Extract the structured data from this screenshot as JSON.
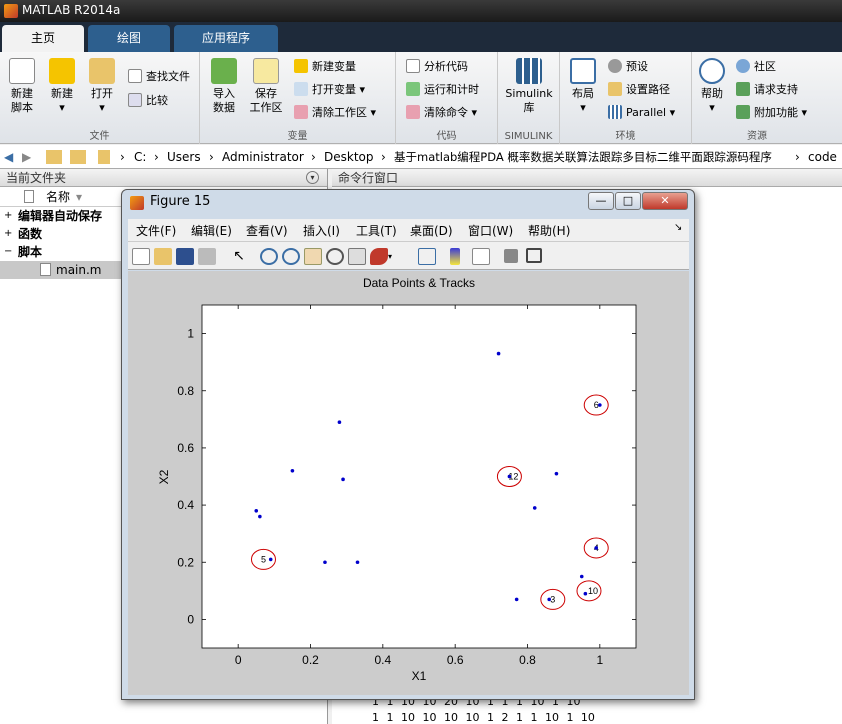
{
  "app": {
    "title": "MATLAB R2014a"
  },
  "ribbon_tabs": [
    {
      "label": "主页",
      "active": true
    },
    {
      "label": "绘图",
      "active": false
    },
    {
      "label": "应用程序",
      "active": false
    }
  ],
  "ribbon": {
    "file_group": {
      "label": "文件",
      "new_script": "新建\n脚本",
      "new": "新建",
      "open": "打开",
      "find_files": "查找文件",
      "compare": "比较"
    },
    "variable_group": {
      "label": "变量",
      "import": "导入\n数据",
      "save_ws": "保存\n工作区",
      "new_var": "新建变量",
      "open_var": "打开变量",
      "clear_ws": "清除工作区"
    },
    "code_group": {
      "label": "代码",
      "analyze": "分析代码",
      "run_time": "运行和计时",
      "clear_cmd": "清除命令"
    },
    "simulink_group": {
      "label": "SIMULINK",
      "simulink": "Simulink\n库"
    },
    "env_group": {
      "label": "环境",
      "layout": "布局",
      "prefs": "预设",
      "set_path": "设置路径",
      "parallel": "Parallel"
    },
    "res_group": {
      "label": "资源",
      "help": "帮助",
      "community": "社区",
      "support": "请求支持",
      "addons": "附加功能"
    }
  },
  "address": {
    "crumbs": [
      "C:",
      "Users",
      "Administrator",
      "Desktop",
      "基于matlab编程PDA 概率数据关联算法跟踪多目标二维平面跟踪源码程序",
      "code"
    ]
  },
  "current_folder": {
    "title": "当前文件夹",
    "col_name": "名称",
    "items": [
      {
        "label": "编辑器自动保存",
        "type": "folder",
        "toggle": "+"
      },
      {
        "label": "函数",
        "type": "folder",
        "toggle": "+"
      },
      {
        "label": "脚本",
        "type": "folder",
        "toggle": "−"
      },
      {
        "label": "main.m",
        "type": "file",
        "selected": true
      }
    ]
  },
  "command_window": {
    "title": "命令行窗口",
    "rows": [
      "1 1 10 10 20 10 1 1 1 10 1 10",
      "1 1 10 10 10 10 1 2 1 1 10 1 10"
    ]
  },
  "figure": {
    "title": "Figure 15",
    "menu": [
      "文件(F)",
      "编辑(E)",
      "查看(V)",
      "插入(I)",
      "工具(T)",
      "桌面(D)",
      "窗口(W)",
      "帮助(H)"
    ],
    "win_buttons": [
      "—",
      "□",
      "✕"
    ]
  },
  "chart_data": {
    "type": "scatter",
    "title": "Data Points & Tracks",
    "xlabel": "X1",
    "ylabel": "X2",
    "xlim": [
      -0.1,
      1.1
    ],
    "ylim": [
      -0.1,
      1.1
    ],
    "xticks": [
      0,
      0.2,
      0.4,
      0.6,
      0.8,
      1
    ],
    "yticks": [
      0,
      0.2,
      0.4,
      0.6,
      0.8,
      1
    ],
    "xticklabels": [
      "0",
      "0.2",
      "0.4",
      "0.6",
      "0.8",
      "1"
    ],
    "yticklabels": [
      "0",
      "0.2",
      "0.4",
      "0.6",
      "0.8",
      "1"
    ],
    "grid": false,
    "point_color": "#0000cc",
    "track_color": "#cc0000",
    "points": [
      [
        0.72,
        0.93
      ],
      [
        0.28,
        0.69
      ],
      [
        0.15,
        0.52
      ],
      [
        0.29,
        0.49
      ],
      [
        0.88,
        0.51
      ],
      [
        0.05,
        0.38
      ],
      [
        0.06,
        0.36
      ],
      [
        0.82,
        0.39
      ],
      [
        0.24,
        0.2
      ],
      [
        0.33,
        0.2
      ],
      [
        0.95,
        0.15
      ],
      [
        0.77,
        0.07
      ],
      [
        0.86,
        0.07
      ],
      [
        0.96,
        0.09
      ],
      [
        0.99,
        0.25
      ],
      [
        1.0,
        0.75
      ],
      [
        0.75,
        0.5
      ],
      [
        0.09,
        0.21
      ]
    ],
    "tracks": [
      {
        "label": "6",
        "x": 0.99,
        "y": 0.75
      },
      {
        "label": "12",
        "x": 0.75,
        "y": 0.5
      },
      {
        "label": "5",
        "x": 0.07,
        "y": 0.21
      },
      {
        "label": "4",
        "x": 0.99,
        "y": 0.25
      },
      {
        "label": "10",
        "x": 0.97,
        "y": 0.1
      },
      {
        "label": "3",
        "x": 0.87,
        "y": 0.07
      }
    ]
  }
}
